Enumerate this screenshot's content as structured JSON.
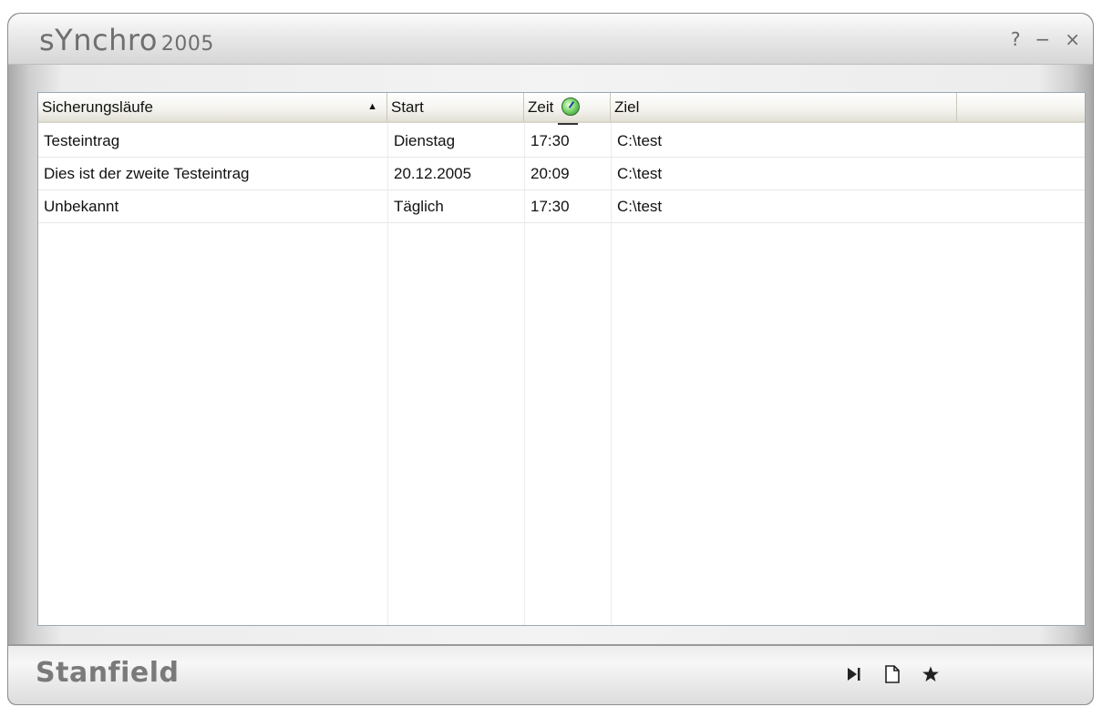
{
  "window": {
    "title": "sYnchro",
    "title_year": "2005",
    "controls": {
      "help": "?",
      "minimize": "−",
      "close": "×"
    }
  },
  "list": {
    "columns": [
      "Sicherungsläufe",
      "Start",
      "Zeit",
      "Ziel"
    ],
    "sort_indicator": "▲",
    "rows": [
      {
        "name": "Testeintrag",
        "start": "Dienstag",
        "time": "17:30",
        "target": "C:\\test"
      },
      {
        "name": "Dies ist der zweite Testeintrag",
        "start": "20.12.2005",
        "time": "20:09",
        "target": "C:\\test"
      },
      {
        "name": "Unbekannt",
        "start": "Täglich",
        "time": "17:30",
        "target": "C:\\test"
      }
    ]
  },
  "footer": {
    "brand": "Stanfield",
    "tools": [
      "play-end-icon",
      "new-document-icon",
      "star-icon"
    ]
  }
}
